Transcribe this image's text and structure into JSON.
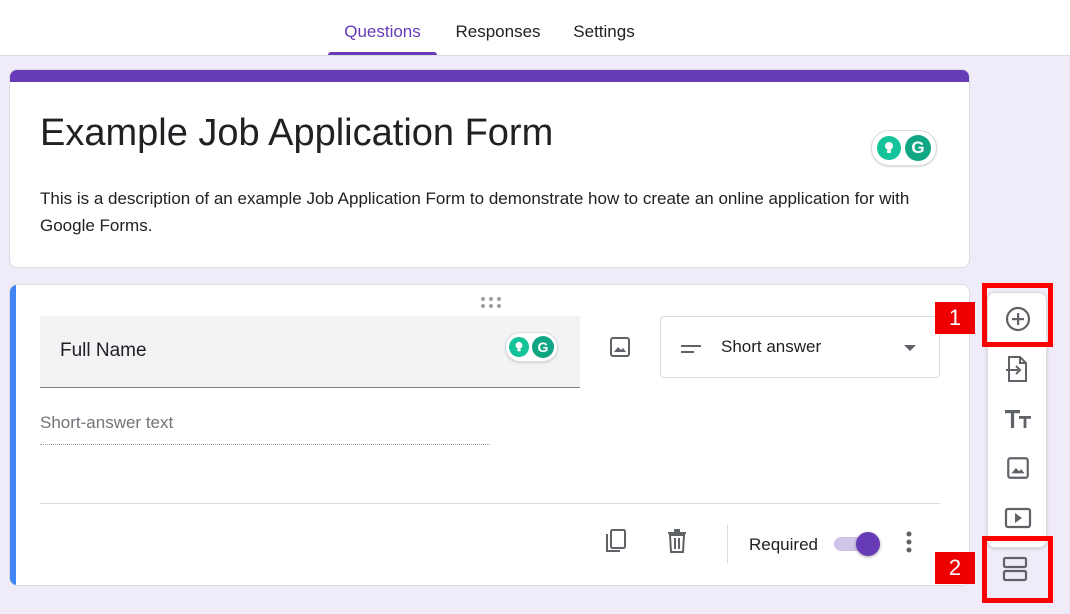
{
  "tabs": {
    "questions": "Questions",
    "responses": "Responses",
    "settings": "Settings"
  },
  "form": {
    "title": "Example Job Application Form",
    "description": "This is a description of an example Job Application Form to demonstrate how to create an online application for with Google Forms."
  },
  "grammarly": {
    "letter": "G"
  },
  "question": {
    "title": "Full Name",
    "type": "Short answer",
    "answer_placeholder": "Short-answer text",
    "required_label": "Required",
    "required": true
  },
  "annotations": {
    "first": "1",
    "second": "2"
  },
  "colors": {
    "accent": "#673ab7",
    "question_accent": "#4285f4",
    "annotation": "#ff0000",
    "grammarly": "#15c39a"
  },
  "icons": {
    "toolbar": [
      "add-question-icon",
      "import-questions-icon",
      "add-title-icon",
      "add-image-icon",
      "add-video-icon",
      "add-section-icon"
    ],
    "question": [
      "drag-handle-icon",
      "image-icon",
      "short-answer-icon",
      "dropdown-caret-icon",
      "duplicate-icon",
      "delete-icon",
      "more-vert-icon"
    ]
  }
}
